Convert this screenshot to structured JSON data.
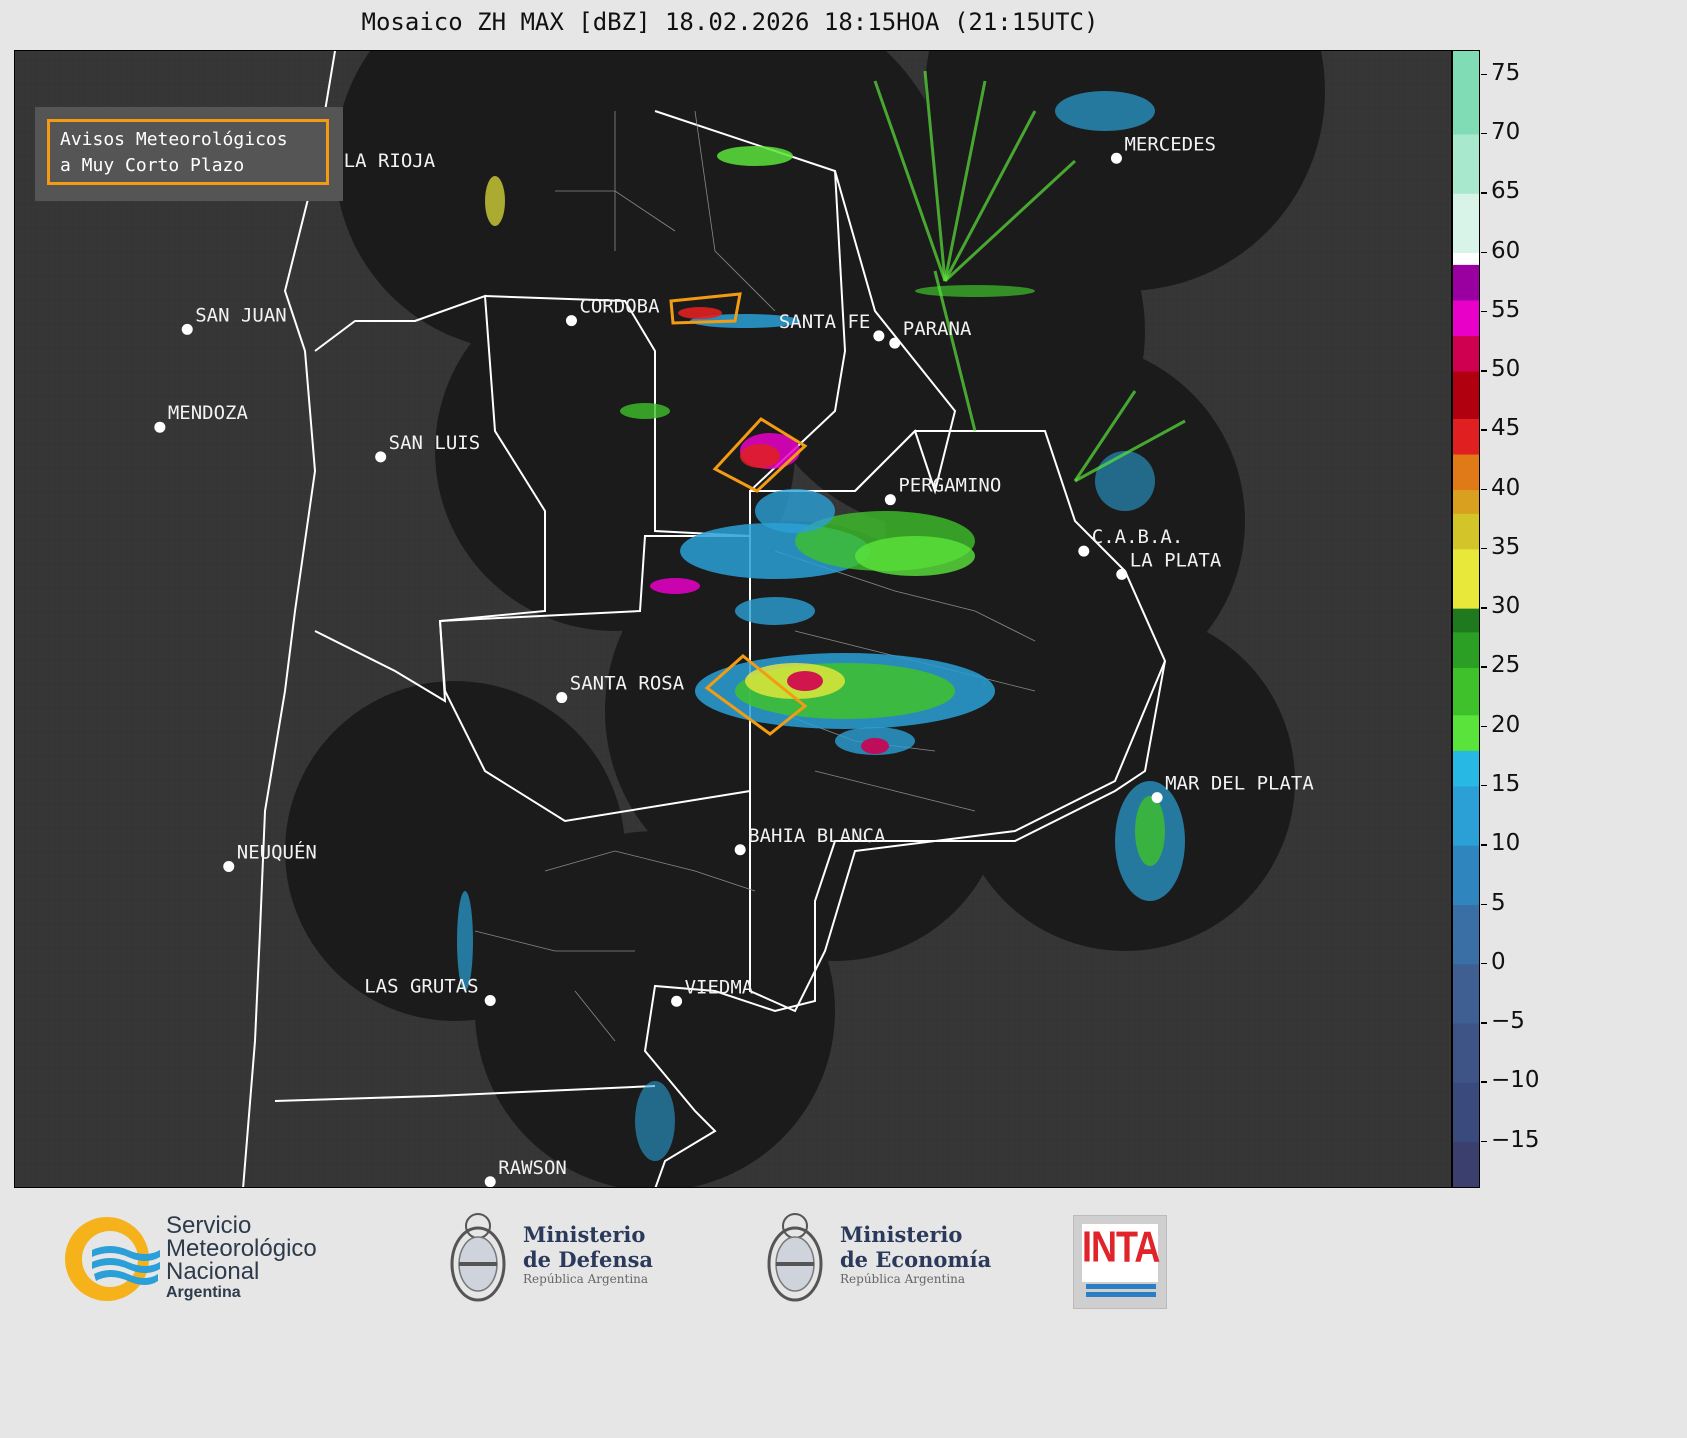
{
  "title": "Mosaico ZH MAX [dBZ] 18.02.2026 18:15HOA (21:15UTC)",
  "legend": {
    "line1": "Avisos Meteorológicos",
    "line2": "a Muy Corto Plazo",
    "color": "#f39c12"
  },
  "cities": [
    {
      "name": "LA RIOJA",
      "lon": -66.85,
      "lat": -29.41
    },
    {
      "name": "CORDOBA",
      "lon": -64.18,
      "lat": -31.42
    },
    {
      "name": "SAN JUAN",
      "lon": -68.53,
      "lat": -31.54
    },
    {
      "name": "SANTA FE",
      "lon": -60.7,
      "lat": -31.63
    },
    {
      "name": "PARANA",
      "lon": -60.52,
      "lat": -31.73
    },
    {
      "name": "MERCEDES",
      "lon": -58.01,
      "lat": -29.18
    },
    {
      "name": "MENDOZA",
      "lon": -68.84,
      "lat": -32.89
    },
    {
      "name": "SAN LUIS",
      "lon": -66.34,
      "lat": -33.3
    },
    {
      "name": "PERGAMINO",
      "lon": -60.57,
      "lat": -33.89
    },
    {
      "name": "C.A.B.A.",
      "lon": -58.38,
      "lat": -34.6
    },
    {
      "name": "LA PLATA",
      "lon": -57.95,
      "lat": -34.92
    },
    {
      "name": "SANTA ROSA",
      "lon": -64.29,
      "lat": -36.62
    },
    {
      "name": "MAR DEL PLATA",
      "lon": -57.55,
      "lat": -38.0
    },
    {
      "name": "BAHIA BLANCA",
      "lon": -62.27,
      "lat": -38.72
    },
    {
      "name": "NEUQUÉN",
      "lon": -68.06,
      "lat": -38.95
    },
    {
      "name": "LAS GRUTAS",
      "lon": -65.1,
      "lat": -40.8
    },
    {
      "name": "VIEDMA",
      "lon": -62.99,
      "lat": -40.81
    },
    {
      "name": "RAWSON",
      "lon": -65.1,
      "lat": -43.3
    }
  ],
  "colorbar": {
    "unit": "dBZ",
    "min": -19,
    "max": 77,
    "ticks": [
      "75",
      "70",
      "65",
      "60",
      "55",
      "50",
      "45",
      "40",
      "35",
      "30",
      "25",
      "20",
      "15",
      "10",
      "5",
      "0",
      "−5",
      "−10",
      "−15"
    ],
    "tick_values": [
      75,
      70,
      65,
      60,
      55,
      50,
      45,
      40,
      35,
      30,
      25,
      20,
      15,
      10,
      5,
      0,
      -5,
      -10,
      -15
    ],
    "bands": [
      {
        "from": -19,
        "to": -15,
        "color": "#3a3f6e"
      },
      {
        "from": -15,
        "to": -10,
        "color": "#3b4a7c"
      },
      {
        "from": -10,
        "to": -5,
        "color": "#3e5486"
      },
      {
        "from": -5,
        "to": 0,
        "color": "#3f5f92"
      },
      {
        "from": 0,
        "to": 5,
        "color": "#3a6fa6"
      },
      {
        "from": 5,
        "to": 10,
        "color": "#2f86bf"
      },
      {
        "from": 10,
        "to": 15,
        "color": "#2aa0d6"
      },
      {
        "from": 15,
        "to": 18,
        "color": "#28b8e4"
      },
      {
        "from": 18,
        "to": 21,
        "color": "#5ae33b"
      },
      {
        "from": 21,
        "to": 25,
        "color": "#3ec12b"
      },
      {
        "from": 25,
        "to": 28,
        "color": "#2b9f23"
      },
      {
        "from": 28,
        "to": 30,
        "color": "#1f7a1f"
      },
      {
        "from": 30,
        "to": 35,
        "color": "#e8e83a"
      },
      {
        "from": 35,
        "to": 38,
        "color": "#d3c42a"
      },
      {
        "from": 38,
        "to": 40,
        "color": "#d9a020"
      },
      {
        "from": 40,
        "to": 43,
        "color": "#e07a18"
      },
      {
        "from": 43,
        "to": 46,
        "color": "#e02020"
      },
      {
        "from": 46,
        "to": 50,
        "color": "#b00010"
      },
      {
        "from": 50,
        "to": 53,
        "color": "#d00050"
      },
      {
        "from": 53,
        "to": 56,
        "color": "#e800c8"
      },
      {
        "from": 56,
        "to": 59,
        "color": "#9a00a0"
      },
      {
        "from": 59,
        "to": 60,
        "color": "#ffffff"
      },
      {
        "from": 60,
        "to": 65,
        "color": "#d8f4e8"
      },
      {
        "from": 65,
        "to": 70,
        "color": "#a8e8cc"
      },
      {
        "from": 70,
        "to": 77,
        "color": "#7fdcb4"
      }
    ]
  },
  "logos": {
    "smn": {
      "line1": "Servicio",
      "line2": "Meteorológico",
      "line3": "Nacional",
      "line4": "Argentina"
    },
    "defensa": {
      "line1": "Ministerio",
      "line2": "de Defensa",
      "line3": "República Argentina"
    },
    "economia": {
      "line1": "Ministerio",
      "line2": "de Economía",
      "line3": "República Argentina"
    },
    "inta": {
      "text": "INTA"
    }
  }
}
